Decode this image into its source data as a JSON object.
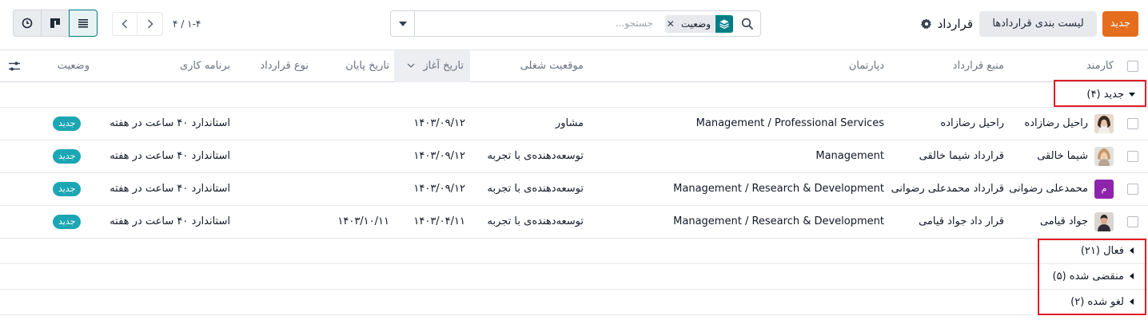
{
  "control_panel": {
    "new_button": "جدید",
    "list_contracts_button": "لیست بندی قراردادها",
    "breadcrumb_title": "قرارداد",
    "search": {
      "placeholder": "جستجو...",
      "facet_label": "وضعیت"
    },
    "pager": {
      "value": "۱-۴ / ۴"
    },
    "views": [
      "list-view",
      "kanban-view",
      "activity-view"
    ],
    "active_view": "list-view"
  },
  "table": {
    "columns": {
      "employee": "کارمند",
      "contract_ref": "منبع قرارداد",
      "department": "دپارتمان",
      "job_position": "موقعیت شغلی",
      "start_date": "تاریخ آغاز",
      "end_date": "تاریخ پایان",
      "contract_type": "نوع قرارداد",
      "schedule": "برنامه کاری",
      "status": "وضعیت"
    },
    "groups": [
      {
        "label": "جدید (۴)",
        "expanded": true
      },
      {
        "label": "فعال (۲۱)",
        "expanded": false
      },
      {
        "label": "منقضی شده (۵)",
        "expanded": false
      },
      {
        "label": "لغو شده (۲)",
        "expanded": false
      }
    ],
    "rows": [
      {
        "employee": "راحیل رضازاده",
        "contract_ref": "راحیل رضازاده",
        "department": "Management / Professional Services",
        "job_position": "مشاور",
        "start_date": "۱۴۰۳/۰۹/۱۲",
        "end_date": "",
        "contract_type": "",
        "schedule": "استاندارد ۴۰ ساعت در هفته",
        "status": "جدید",
        "avatar": "photo-f1"
      },
      {
        "employee": "شیما خالقی",
        "contract_ref": "قرارداد شیما خالقی",
        "department": "Management",
        "job_position": "توسعه‌دهنده‌ی با تجربه",
        "start_date": "۱۴۰۳/۰۹/۱۲",
        "end_date": "",
        "contract_type": "",
        "schedule": "استاندارد ۴۰ ساعت در هفته",
        "status": "جدید",
        "avatar": "photo-f2"
      },
      {
        "employee": "محمدعلی رضوانی",
        "contract_ref": "قرارداد محمدعلی رضوانی",
        "department": "Management / Research & Development",
        "job_position": "توسعه‌دهنده‌ی با تجربه",
        "start_date": "۱۴۰۳/۰۹/۱۲",
        "end_date": "",
        "contract_type": "",
        "schedule": "استاندارد ۴۰ ساعت در هفته",
        "status": "جدید",
        "avatar": "م"
      },
      {
        "employee": "جواد قیامی",
        "contract_ref": "قرار داد جواد قیامی",
        "department": "Management / Research & Development",
        "job_position": "توسعه‌دهنده‌ی با تجربه",
        "start_date": "۱۴۰۳/۰۴/۱۱",
        "end_date": "۱۴۰۳/۱۰/۱۱",
        "contract_type": "",
        "schedule": "استاندارد ۴۰ ساعت در هفته",
        "status": "جدید",
        "avatar": "photo-m1"
      }
    ]
  },
  "colors": {
    "primary": "#e46e1d",
    "accent": "#017e84",
    "badge": "#1ca6b3",
    "highlight": "#e11d27",
    "avatar_letter_bg": "#8e24aa"
  }
}
